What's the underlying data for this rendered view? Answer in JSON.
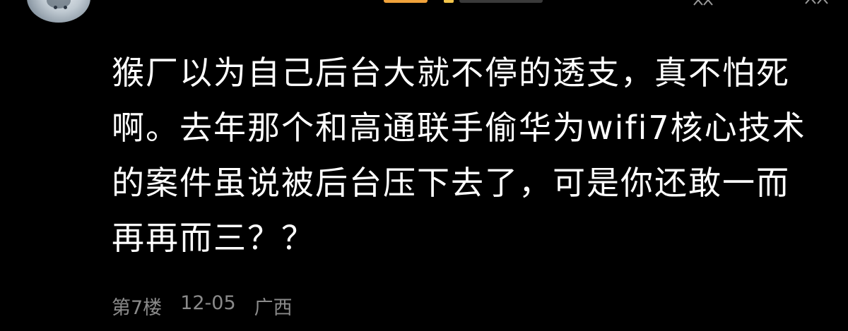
{
  "comment": {
    "username": "",
    "text": "猴厂以为自己后台大就不停的透支，真不怕死啊。去年那个和高通联手偷华为wifi7核心技术的案件虽说被后台压下去了，可是你还敢一而再再而三？？",
    "floor": "第7楼",
    "date": "12-05",
    "location": "广西"
  },
  "icons": {
    "avatar": "avatar",
    "more": "more-icon",
    "like": "like-icon"
  },
  "colors": {
    "background": "#000000",
    "text": "#ffffff",
    "meta": "#8a8a8a",
    "badge_orange": "#f0a23b",
    "badge_yellow": "#f3c44a"
  }
}
